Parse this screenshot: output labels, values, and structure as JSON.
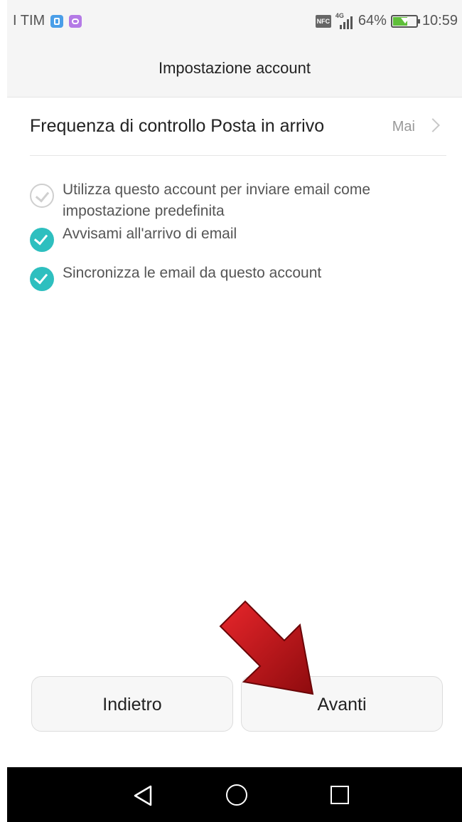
{
  "status_bar": {
    "carrier": "I TIM",
    "network_type": "4G",
    "battery_percent": "64%",
    "battery_level": 0.64,
    "time": "10:59",
    "nfc_label": "NFC"
  },
  "header": {
    "title": "Impostazione account"
  },
  "settings": {
    "frequency": {
      "label": "Frequenza di controllo Posta in arrivo",
      "value": "Mai"
    },
    "options": [
      {
        "label": "Utilizza questo account per inviare email come impostazione predefinita",
        "checked": false
      },
      {
        "label": "Avvisami all'arrivo di email",
        "checked": true
      },
      {
        "label": "Sincronizza le email da questo account",
        "checked": true
      }
    ]
  },
  "buttons": {
    "back_label": "Indietro",
    "next_label": "Avanti"
  },
  "colors": {
    "accent": "#2ebfbf",
    "annotation_arrow": "#c8161b"
  },
  "icons": {
    "nav_back": "back-triangle-icon",
    "nav_home": "home-circle-icon",
    "nav_recent": "recent-square-icon"
  }
}
